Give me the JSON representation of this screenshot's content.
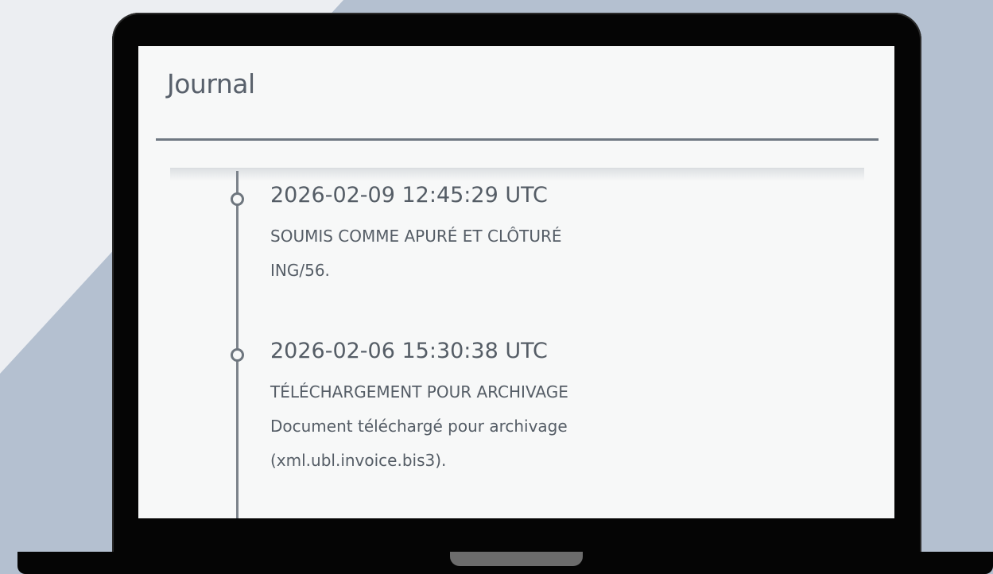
{
  "panel": {
    "title": "Journal"
  },
  "entries": [
    {
      "timestamp": "2026-02-09 12:45:29 UTC",
      "event": "SOUMIS COMME APURÉ ET CLÔTURÉ",
      "details": [
        "ING/56."
      ]
    },
    {
      "timestamp": "2026-02-06 15:30:38 UTC",
      "event": "TÉLÉCHARGEMENT POUR ARCHIVAGE",
      "details": [
        "Document téléchargé pour archivage",
        "(xml.ubl.invoice.bis3)."
      ]
    }
  ],
  "colors": {
    "background_accent": "#b4c0d0",
    "background_light": "#eceef2",
    "screen": "#f7f8f8",
    "text": "#555d66",
    "rule": "#6f7882",
    "timeline": "#7c838b"
  },
  "icons": {
    "timeline_node": "timeline-node-icon"
  }
}
